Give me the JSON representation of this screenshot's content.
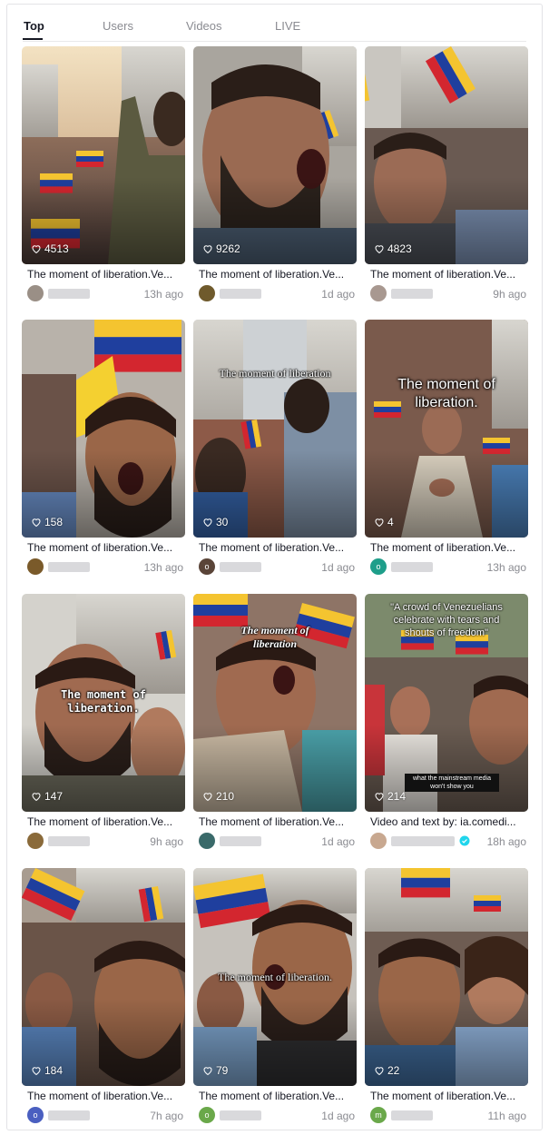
{
  "tabs": [
    {
      "label": "Top",
      "active": true
    },
    {
      "label": "Users",
      "active": false
    },
    {
      "label": "Videos",
      "active": false
    },
    {
      "label": "LIVE",
      "active": false
    }
  ],
  "videos": [
    {
      "likes": "4513",
      "caption": "The moment of liberation.Ve...",
      "time": "13h ago",
      "avatar": "",
      "avatar_color": "#9a8f86",
      "overlay": ""
    },
    {
      "likes": "9262",
      "caption": "The moment of liberation.Ve...",
      "time": "1d ago",
      "avatar": "",
      "avatar_color": "#6f5a2c",
      "overlay": ""
    },
    {
      "likes": "4823",
      "caption": "The moment of liberation.Ve...",
      "time": "9h ago",
      "avatar": "",
      "avatar_color": "#a89890",
      "overlay": ""
    },
    {
      "likes": "158",
      "caption": "The moment of liberation.Ve...",
      "time": "13h ago",
      "avatar": "",
      "avatar_color": "#7a5a2a",
      "overlay": ""
    },
    {
      "likes": "30",
      "caption": "The moment of liberation.Ve...",
      "time": "1d ago",
      "avatar": "o",
      "avatar_color": "#5a4438",
      "overlay": "The moment of liberation"
    },
    {
      "likes": "4",
      "caption": "The moment of liberation.Ve...",
      "time": "13h ago",
      "avatar": "o",
      "avatar_color": "#1e9e8a",
      "overlay": "The moment of liberation."
    },
    {
      "likes": "147",
      "caption": "The moment of liberation.Ve...",
      "time": "9h ago",
      "avatar": "",
      "avatar_color": "#8a6a3a",
      "overlay": "The moment of liberation."
    },
    {
      "likes": "210",
      "caption": "The moment of liberation.Ve...",
      "time": "1d ago",
      "avatar": "",
      "avatar_color": "#3a6a6a",
      "overlay": "The moment of liberation"
    },
    {
      "likes": "214",
      "caption": "Video and text by: ia.comedi...",
      "time": "18h ago",
      "avatar": "",
      "avatar_color": "#c8a890",
      "overlay": "\"A crowd of Venezuelians celebrate with tears and shouts of freedom\"",
      "overlay2": "what the mainstream media won't show you",
      "verified": true
    },
    {
      "likes": "184",
      "caption": "The moment of liberation.Ve...",
      "time": "7h ago",
      "avatar": "o",
      "avatar_color": "#4a5fc0",
      "overlay": ""
    },
    {
      "likes": "79",
      "caption": "The moment of liberation.Ve...",
      "time": "1d ago",
      "avatar": "o",
      "avatar_color": "#6aa84a",
      "overlay": "The moment of liberation."
    },
    {
      "likes": "22",
      "caption": "The moment of liberation.Ve...",
      "time": "11h ago",
      "avatar": "m",
      "avatar_color": "#6aa84a",
      "overlay": ""
    }
  ],
  "colors": {
    "flag_yellow": "#f4c430",
    "flag_blue": "#1f3f9e",
    "flag_red": "#d3262f"
  }
}
